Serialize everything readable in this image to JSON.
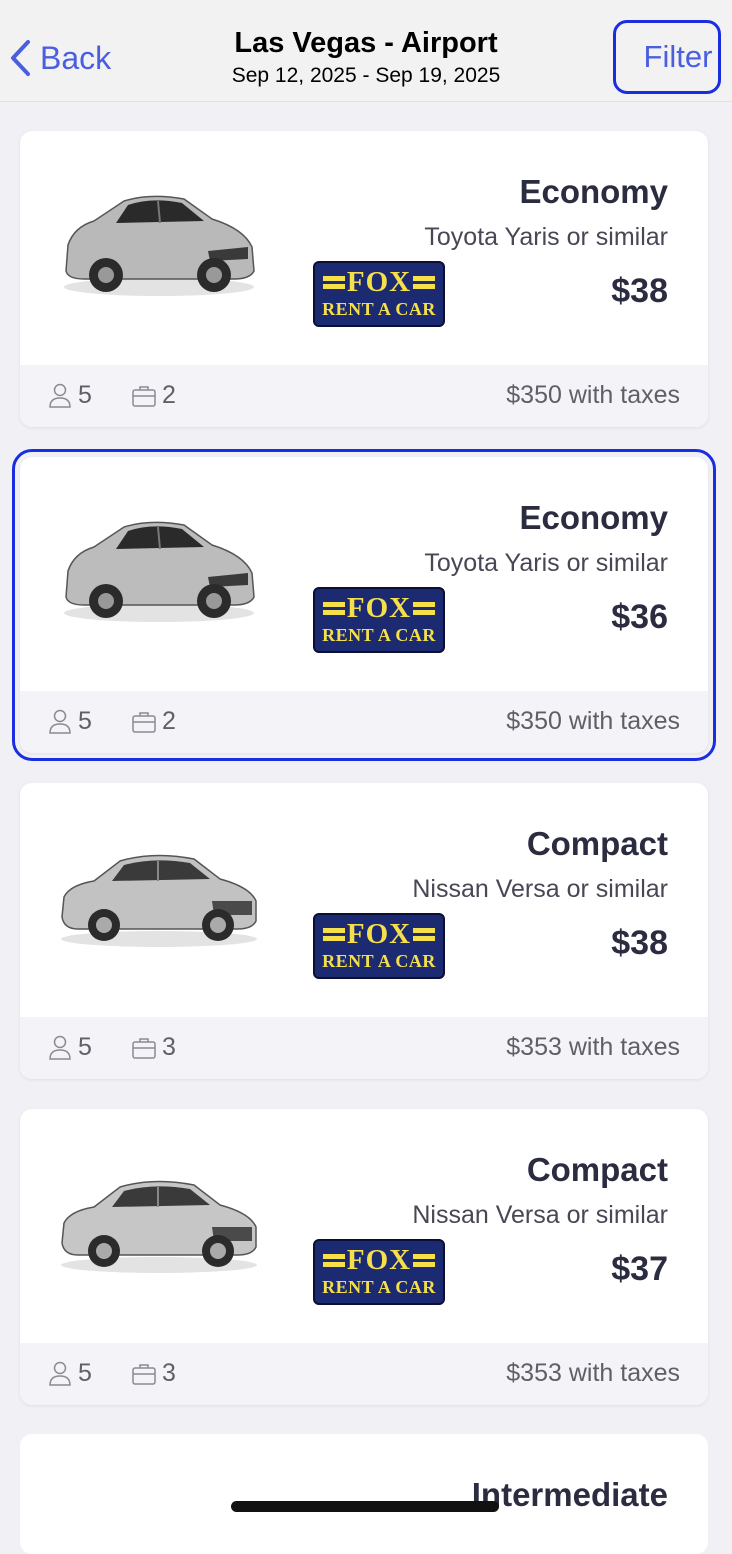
{
  "header": {
    "back_label": "Back",
    "title": "Las Vegas - Airport",
    "dates": "Sep 12, 2025 - Sep 19, 2025",
    "filter_label": "Filter"
  },
  "results": [
    {
      "class": "Economy",
      "model": "Toyota Yaris or similar",
      "price": "$38",
      "passengers": "5",
      "bags": "2",
      "total": "$350 with taxes",
      "vendor_top": "FOX",
      "vendor_bottom": "RENT A CAR",
      "car_icon": "hatchback-car"
    },
    {
      "class": "Economy",
      "model": "Toyota Yaris or similar",
      "price": "$36",
      "passengers": "5",
      "bags": "2",
      "total": "$350 with taxes",
      "vendor_top": "FOX",
      "vendor_bottom": "RENT A CAR",
      "car_icon": "hatchback-car"
    },
    {
      "class": "Compact",
      "model": "Nissan Versa or similar",
      "price": "$38",
      "passengers": "5",
      "bags": "3",
      "total": "$353 with taxes",
      "vendor_top": "FOX",
      "vendor_bottom": "RENT A CAR",
      "car_icon": "sedan-car"
    },
    {
      "class": "Compact",
      "model": "Nissan Versa or similar",
      "price": "$37",
      "passengers": "5",
      "bags": "3",
      "total": "$353 with taxes",
      "vendor_top": "FOX",
      "vendor_bottom": "RENT A CAR",
      "car_icon": "sedan-car"
    }
  ],
  "partial_card": {
    "class": "Intermediate"
  },
  "colors": {
    "accent": "#4a5fe0",
    "selection": "#1a2ee0",
    "logo_bg": "#1c2a72",
    "logo_text": "#f5e04a"
  }
}
